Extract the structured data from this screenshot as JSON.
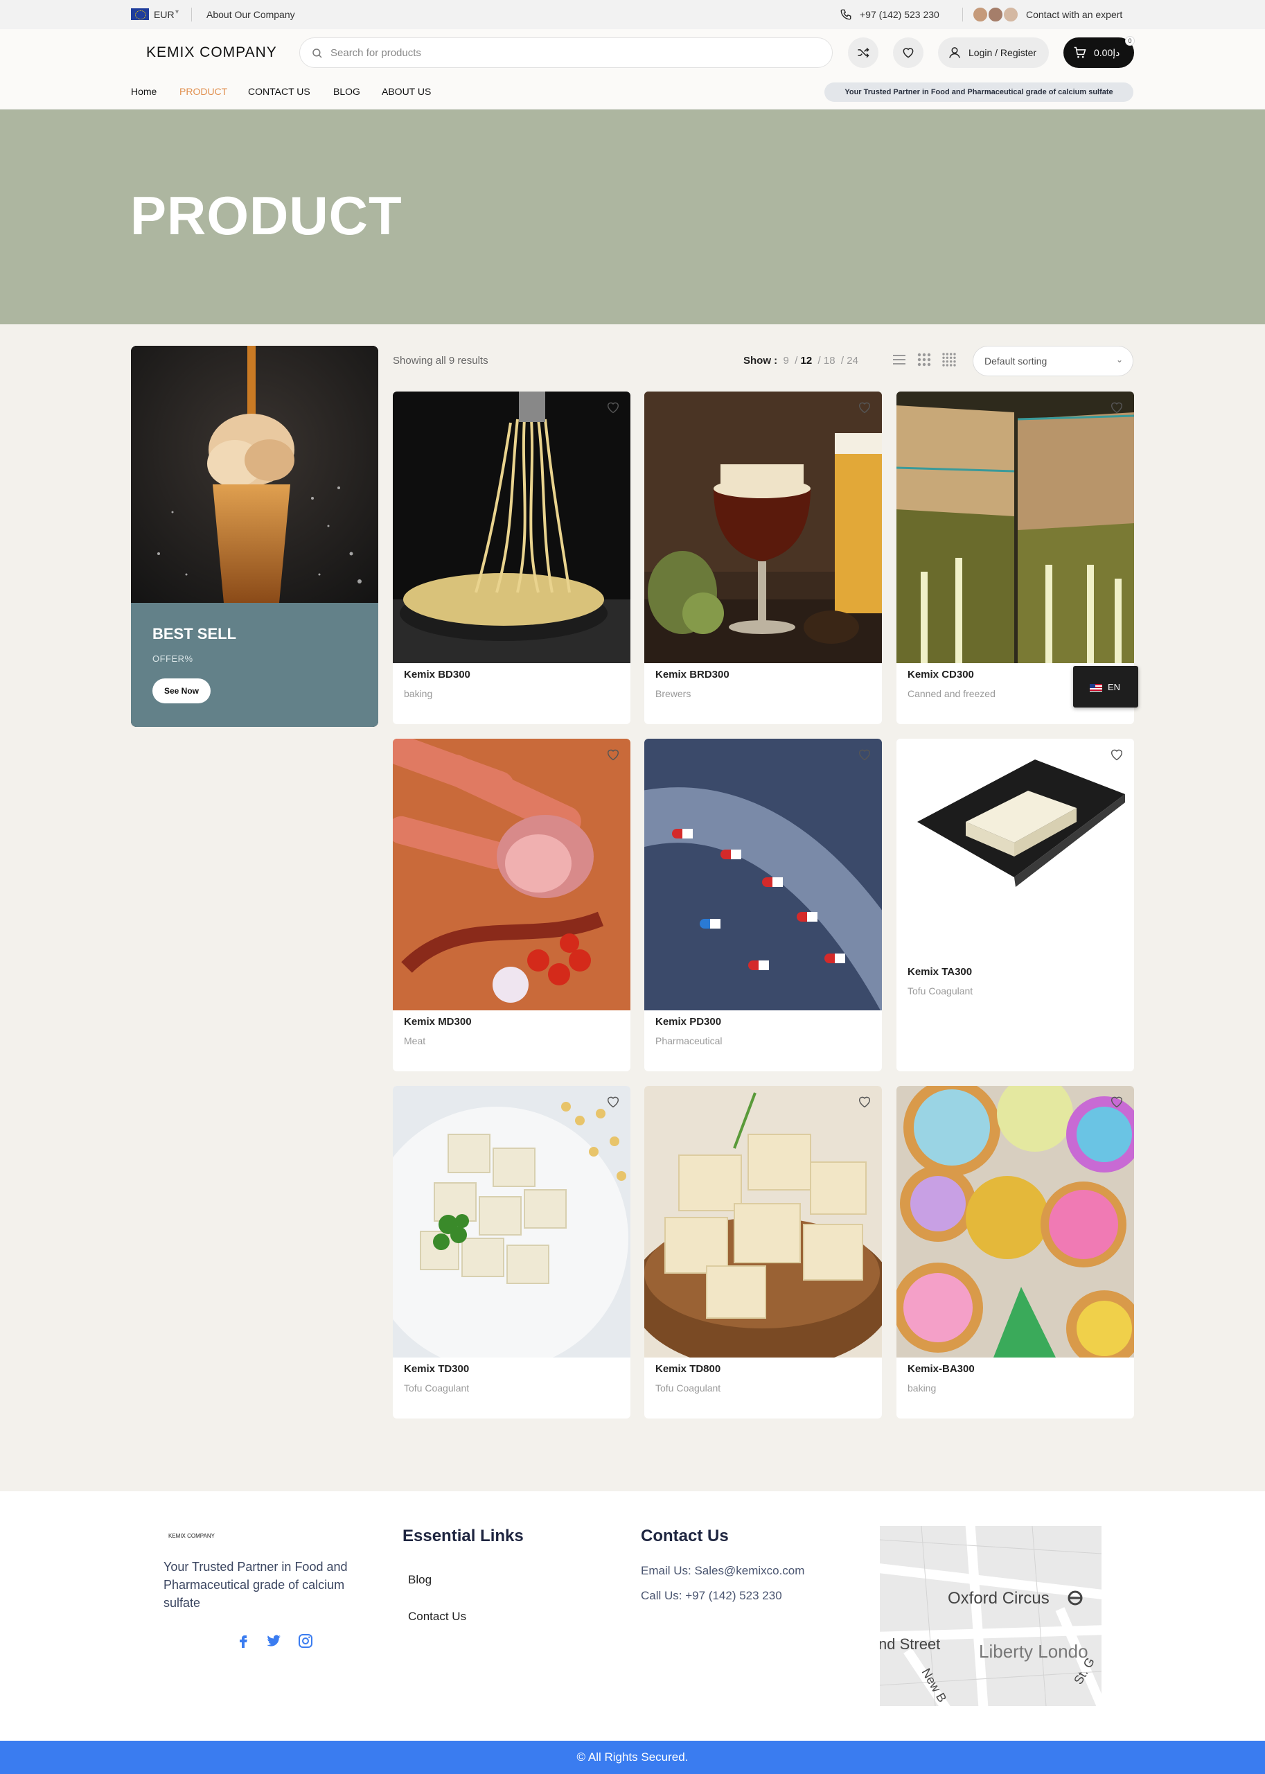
{
  "topbar": {
    "currency": "EUR",
    "about_link": "About Our Company",
    "phone": "+97 (142) 523 230",
    "contact_expert": "Contact with an expert"
  },
  "header": {
    "logo": "KEMIX COMPANY",
    "search_placeholder": "Search for products",
    "login_label": "Login / Register",
    "cart_total": "دإ0.00",
    "cart_count": "0",
    "nav": [
      {
        "label": "Home"
      },
      {
        "label": "PRODUCT"
      },
      {
        "label": "CONTACT US"
      },
      {
        "label": "BLOG"
      },
      {
        "label": "ABOUT US"
      }
    ],
    "tagline": "Your Trusted Partner in Food and Pharmaceutical grade of calcium sulfate"
  },
  "hero": {
    "title": "PRODUCT"
  },
  "promo": {
    "title": "BEST SELL",
    "subtitle": "OFFER%",
    "button": "See Now"
  },
  "toolbar": {
    "results": "Showing all 9 results",
    "show_label": "Show :",
    "show_options": [
      "9",
      "12",
      "18",
      "24"
    ],
    "show_selected": "12",
    "sort": "Default sorting"
  },
  "products": [
    {
      "name": "Kemix BD300",
      "category": "baking",
      "image": "noodles"
    },
    {
      "name": "Kemix BRD300",
      "category": "Brewers",
      "image": "beer"
    },
    {
      "name": "Kemix CD300",
      "category": "Canned and freezed",
      "image": "pickle-jars"
    },
    {
      "name": "Kemix MD300",
      "category": "Meat",
      "image": "sausages"
    },
    {
      "name": "Kemix PD300",
      "category": "Pharmaceutical",
      "image": "capsules"
    },
    {
      "name": "Kemix TA300",
      "category": "Tofu Coagulant",
      "image": "tofu-plate"
    },
    {
      "name": "Kemix TD300",
      "category": "Tofu Coagulant",
      "image": "tofu-cubes"
    },
    {
      "name": "Kemix TD800",
      "category": "Tofu Coagulant",
      "image": "tofu-bowl"
    },
    {
      "name": "Kemix-BA300",
      "category": "baking",
      "image": "cookies"
    }
  ],
  "language": {
    "label": "EN"
  },
  "footer": {
    "logo": "KEMIX COMPANY",
    "tagline": "Your Trusted Partner in Food and Pharmaceutical grade of calcium sulfate",
    "links_heading": "Essential Links",
    "links": [
      "Blog",
      "Contact Us"
    ],
    "contact_heading": "Contact Us",
    "email": "Email Us: Sales@kemixco.com",
    "phone": "Call Us: +97 (142) 523 230",
    "map_labels": [
      "Oxford Circus",
      "nd Street",
      "Liberty Londo",
      "New B",
      "St. G"
    ],
    "copyright": "© All Rights Secured."
  },
  "colors": {
    "hero_bg": "#adb6a0",
    "accent_nav": "#e08f4e",
    "promo_box": "#638189",
    "footer_bar": "#3a7cf0",
    "cart_bg": "#111111"
  }
}
